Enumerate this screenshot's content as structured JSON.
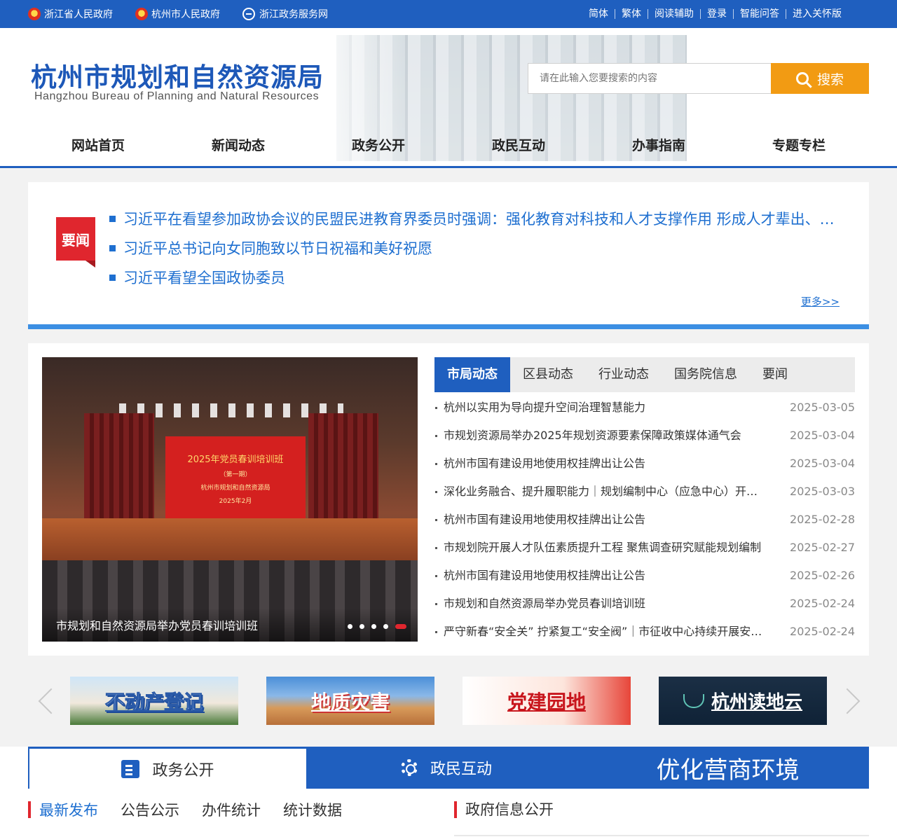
{
  "topbar": {
    "links_left": [
      "浙江省人民政府",
      "杭州市人民政府",
      "浙江政务服务网"
    ],
    "links_right": [
      "简体",
      "繁体",
      "阅读辅助",
      "登录",
      "智能问答",
      "进入关怀版"
    ]
  },
  "header": {
    "title": "杭州市规划和自然资源局",
    "subtitle": "Hangzhou Bureau of Planning and Natural Resources",
    "search_placeholder": "请在此输入您要搜索的内容",
    "search_button": "搜索"
  },
  "nav": [
    "网站首页",
    "新闻动态",
    "政务公开",
    "政民互动",
    "办事指南",
    "专题专栏"
  ],
  "headline": {
    "tag": "要闻",
    "items": [
      "习近平在看望参加政协会议的民盟民进教育界委员时强调：强化教育对科技和人才支撑作用 形成人才辈出、人尽其才、才尽其用生动局面",
      "习近平总书记向女同胞致以节日祝福和美好祝愿",
      "习近平看望全国政协委员"
    ],
    "more": "更多>>"
  },
  "news": {
    "photo": {
      "screen_title": "2025年党员春训培训班",
      "screen_sub": "（第一期）",
      "screen_org": "杭州市规划和自然资源局",
      "screen_date": "2025年2月",
      "caption": "市规划和自然资源局举办党员春训培训班"
    },
    "tabs": [
      "市局动态",
      "区县动态",
      "行业动态",
      "国务院信息",
      "要闻"
    ],
    "items": [
      {
        "title": "杭州以实用为导向提升空间治理智慧能力",
        "date": "2025-03-05"
      },
      {
        "title": "市规划资源局举办2025年规划资源要素保障政策媒体通气会",
        "date": "2025-03-04"
      },
      {
        "title": "杭州市国有建设用地使用权挂牌出让公告",
        "date": "2025-03-04"
      },
      {
        "title": "深化业务融合、提升履职能力｜规划编制中心（应急中心）开展业务学习交流",
        "date": "2025-03-03"
      },
      {
        "title": "杭州市国有建设用地使用权挂牌出让公告",
        "date": "2025-02-28"
      },
      {
        "title": "市规划院开展人才队伍素质提升工程 聚焦调查研究赋能规划编制",
        "date": "2025-02-27"
      },
      {
        "title": "杭州市国有建设用地使用权挂牌出让公告",
        "date": "2025-02-26"
      },
      {
        "title": "市规划和自然资源局举办党员春训培训班",
        "date": "2025-02-24"
      },
      {
        "title": "严守新春“安全关” 拧紧复工“安全阀”｜市征收中心持续开展安全生产检查",
        "date": "2025-02-24"
      }
    ]
  },
  "banners": [
    "不动产登记",
    "地质灾害",
    "党建园地",
    "杭州读地云"
  ],
  "bottom": {
    "tabs": [
      "政务公开",
      "政民互动",
      "优化营商环境"
    ],
    "subtabs": [
      "最新发布",
      "公告公示",
      "办件统计",
      "统计数据"
    ],
    "gov_info": "政府信息公开"
  },
  "colors": {
    "brand_blue": "#1f5fbf",
    "accent_orange": "#f29b13",
    "accent_red": "#e0262e",
    "link_blue": "#1e6fd0"
  }
}
